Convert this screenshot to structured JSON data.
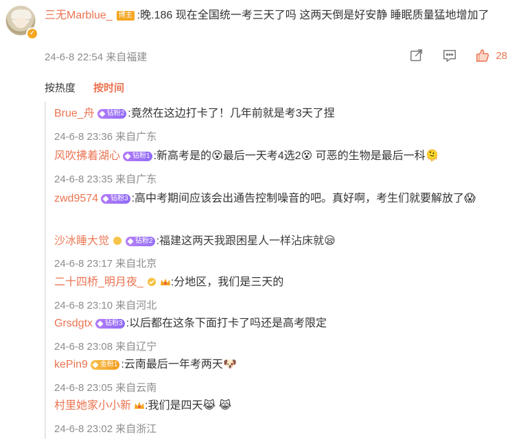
{
  "main_post": {
    "author": "三无Marblue_",
    "author_badge": "博主",
    "text": ":晚.186 现在全国统一考三天了吗 这两天倒是好安静 睡眠质量猛地增加了",
    "meta": "24-6-8 22:54 来自福建",
    "likes": "28",
    "icons": [
      "share-icon",
      "comment-icon",
      "like-icon"
    ]
  },
  "sort": {
    "hot": "按热度",
    "time": "按时间",
    "active": "time"
  },
  "replies": [
    {
      "name": "Brue_舟",
      "badge": "钻粉2",
      "badge_type": "diamond",
      "text": ":竟然在这边打卡了！几年前就是考3天了捏",
      "emojis": [],
      "meta": "24-6-8 23:36 来自广东"
    },
    {
      "name": "风吹拂着湖心",
      "badge": "钻粉1",
      "badge_type": "diamond",
      "text_parts": [
        ":新高考是的",
        "最后一天考4选2",
        " 可恶的生物是最后一科"
      ],
      "emojis": [
        "😵",
        "😵",
        "🫠"
      ],
      "meta": "24-6-8 23:35 来自广东"
    },
    {
      "name": "zwd9574",
      "badge": "钻粉3",
      "badge_type": "diamond",
      "text": ":高中考期间应该会出通告控制噪音的吧。真好啊，考生们就要解放了",
      "emojis": [
        "😱"
      ],
      "meta": ""
    },
    {
      "name": "沙冰睡大觉",
      "badge": "钻粉2",
      "badge_type": "diamond",
      "text": ":福建这两天我跟困星人一样沾床就",
      "emojis": [
        "😪"
      ],
      "meta": "24-6-8 23:17 来自北京"
    },
    {
      "name": "二十四桥_明月夜_",
      "badge": "",
      "badge_type": "crown",
      "text": ":分地区，我们是三天的",
      "emojis": [],
      "meta": "24-6-8 23:10 来自河北"
    },
    {
      "name": "Grsdgtx",
      "badge": "钻粉3",
      "badge_type": "diamond",
      "text": ":以后都在这条下面打卡了吗还是高考限定",
      "emojis": [],
      "meta": "24-6-8 23:08 来自辽宁"
    },
    {
      "name": "kePin9",
      "badge": "金粉1",
      "badge_type": "gold",
      "text": ":云南最后一年考两天",
      "emojis": [
        "🐶"
      ],
      "meta": "24-6-8 23:05 来自云南"
    },
    {
      "name": "村里她家小小新",
      "badge": "",
      "badge_type": "crown",
      "text": ":我们是四天",
      "emojis": [
        "😹",
        "😹"
      ],
      "meta": "24-6-8 23:02 来自浙江"
    }
  ],
  "colors": {
    "accent": "#eb7350",
    "meta": "#8c8c8c",
    "text": "#333333"
  }
}
